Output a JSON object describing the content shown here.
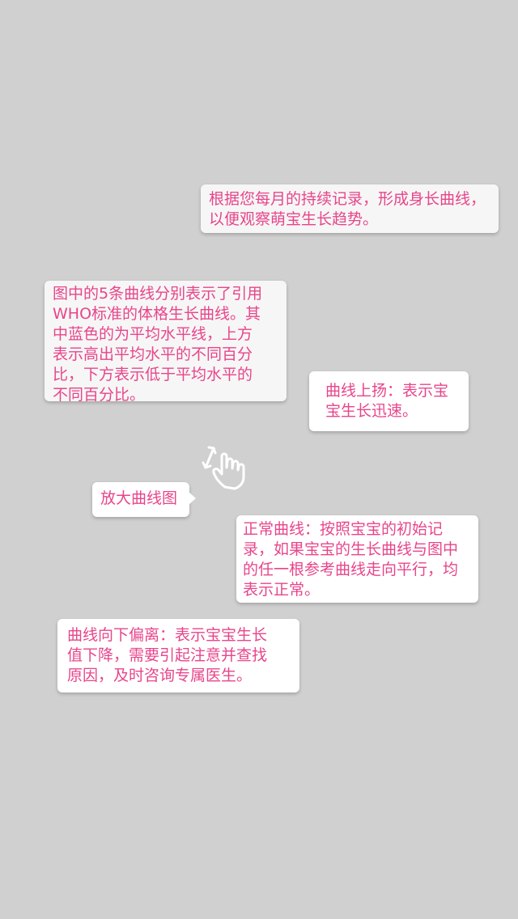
{
  "guide": {
    "record_tip": "根据您每月的持续记录，形成身长曲线，\n以便观察萌宝生长趋势。",
    "curves_tip": "图中的5条曲线分别表示了引用\nWHO标准的体格生长曲线。其\n中蓝色的为平均水平线，上方\n表示高出平均水平的不同百分\n比，下方表示低于平均水平的\n不同百分比。",
    "rise_tip": "曲线上扬：表示宝\n宝生长迅速。",
    "zoom_label": "放大曲线图",
    "normal_tip": "正常曲线：按照宝宝的初始记\n录，如果宝宝的生长曲线与图中\n的任一根参考曲线走向平行，均\n表示正常。",
    "deviate_tip": "曲线向下偏离：表示宝宝生长\n值下降，需要引起注意并查找\n原因，及时咨询专属医生。",
    "gesture_icon": "pinch-zoom-hand-icon"
  },
  "colors": {
    "overlay_background": "#d0d0d0",
    "text_accent": "#e8458b",
    "bubble_white": "#ffffff",
    "bubble_grey": "#f6f6f6"
  }
}
